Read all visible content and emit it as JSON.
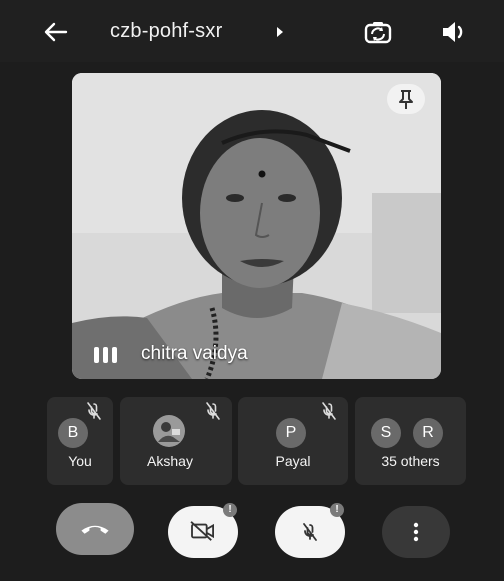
{
  "header": {
    "meeting_code": "czb-pohf-sxr"
  },
  "main_speaker": {
    "name": "chitra vaidya"
  },
  "participants": [
    {
      "initial": "B",
      "label": "You"
    },
    {
      "initial": "",
      "label": "Akshay"
    },
    {
      "initial": "P",
      "label": "Payal"
    },
    {
      "initials": [
        "S",
        "R"
      ],
      "label": "35 others"
    }
  ],
  "controls": {
    "camera_badge": "!",
    "mic_badge": "!"
  },
  "icons": [
    "back-arrow-icon",
    "chevron-right-icon",
    "switch-camera-icon",
    "speaker-icon",
    "pin-icon",
    "audio-level-icon",
    "mic-off-icon",
    "end-call-icon",
    "camera-off-icon",
    "more-vert-icon"
  ]
}
